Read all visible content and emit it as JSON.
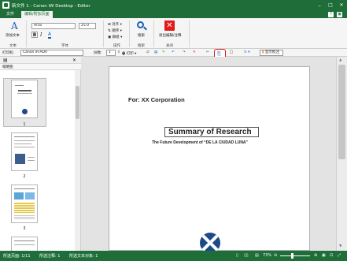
{
  "window": {
    "title": "新文件 1 - Canon iW Desktop - Editor",
    "help": "?",
    "minimize": "–",
    "maximize": "□",
    "close": "✕"
  },
  "tabs": {
    "file": "文件",
    "edit": "编辑/附加页面"
  },
  "ribbon": {
    "text": {
      "add_text": "添加文本",
      "font_name": "Arial",
      "font_size": "25.0",
      "bold": "B",
      "italic": "I",
      "underline": "A",
      "group_text": "文本",
      "group_font": "字体"
    },
    "operate": {
      "align": "对齐",
      "order": "顺序",
      "group_items": "群组",
      "group_label": "操作"
    },
    "search": {
      "label": "搜索",
      "group_label": "搜索"
    },
    "close": {
      "label": "退出编辑/注释",
      "group_label": "关闭"
    }
  },
  "toolbar2": {
    "printer_label": "打印机:",
    "printer_value": "Canon iR-ADV",
    "copies_label": "份数:",
    "copies_value": "1",
    "print_label": "打印",
    "show_annotation": "显示批注"
  },
  "left_pane": {
    "header": "缩略图",
    "thumbnails": [
      {
        "num": "1"
      },
      {
        "num": "2"
      },
      {
        "num": "3"
      }
    ]
  },
  "document": {
    "for_line": "For: XX Corporation",
    "title": "Summary of Research",
    "subtitle": "The Future Development of “DE LA CIUDAD LUNA”"
  },
  "status": {
    "pages": "所选页面: 1/11",
    "annotations": "所选注释: 1",
    "text_objects": "所选文本对象: 1",
    "zoom": "73%"
  },
  "colors": {
    "accent": "#1f6e3a",
    "highlight": "#e21b1b"
  }
}
